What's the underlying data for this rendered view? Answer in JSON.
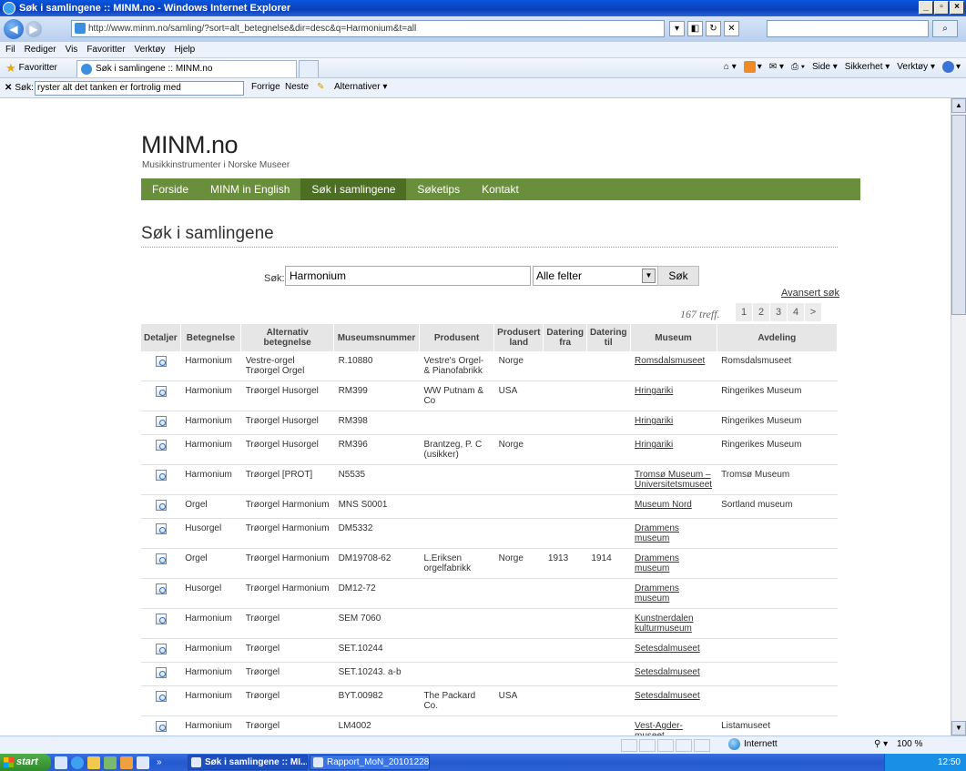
{
  "window": {
    "title": "Søk i samlingene :: MINM.no - Windows Internet Explorer",
    "btn_min": "_",
    "btn_max": "▫",
    "btn_close": "×"
  },
  "addressbar": {
    "back_icon": "◀",
    "forward_icon": "▶",
    "url": "http://www.minm.no/samling/?sort=alt_betegnelse&dir=desc&q=Harmonium&t=all",
    "search_btn_icon": "⌕"
  },
  "menu": [
    "Fil",
    "Rediger",
    "Vis",
    "Favoritter",
    "Verktøy",
    "Hjelp"
  ],
  "favbar": {
    "favorites": "Favoritter",
    "tab_title": "Søk i samlingene :: MINM.no",
    "cmd_side": "Side ▾",
    "cmd_security": "Sikkerhet ▾",
    "cmd_tools": "Verktøy ▾"
  },
  "findbar": {
    "close": "✕",
    "label": "Søk:",
    "value": "ryster alt det tanken er fortrolig med",
    "prev": "Forrige",
    "next": "Neste",
    "options": "Alternativer ▾"
  },
  "site": {
    "title": "MINM.no",
    "subtitle": "Musikkinstrumenter i Norske Museer",
    "nav": [
      "Forside",
      "MINM in English",
      "Søk i samlingene",
      "Søketips",
      "Kontakt"
    ],
    "heading": "Søk i samlingene"
  },
  "search": {
    "label": "Søk:",
    "value": "Harmonium",
    "field_selected": "Alle felter",
    "button": "Søk",
    "advanced": "Avansert søk",
    "hits": "167 treff.",
    "pages": [
      "1",
      "2",
      "3",
      "4",
      ">"
    ]
  },
  "table": {
    "headers": [
      "Detaljer",
      "Betegnelse",
      "Alternativ betegnelse",
      "Museumsnummer",
      "Produsent",
      "Produsert land",
      "Datering fra",
      "Datering til",
      "Museum",
      "Avdeling"
    ],
    "rows": [
      {
        "betegnelse": "Harmonium",
        "alt": "Vestre-orgel Trøorgel Orgel",
        "nr": "R.10880",
        "produsent": "Vestre's Orgel-& Pianofabrikk",
        "land": "Norge",
        "fra": "",
        "til": "",
        "museum": "Romsdalsmuseet",
        "avdeling": "Romsdalsmuseet"
      },
      {
        "betegnelse": "Harmonium",
        "alt": "Trøorgel Husorgel",
        "nr": "RM399",
        "produsent": "WW Putnam & Co",
        "land": "USA",
        "fra": "",
        "til": "",
        "museum": "Hringariki",
        "avdeling": "Ringerikes Museum"
      },
      {
        "betegnelse": "Harmonium",
        "alt": "Trøorgel Husorgel",
        "nr": "RM398",
        "produsent": "",
        "land": "",
        "fra": "",
        "til": "",
        "museum": "Hringariki",
        "avdeling": "Ringerikes Museum"
      },
      {
        "betegnelse": "Harmonium",
        "alt": "Trøorgel Husorgel",
        "nr": "RM396",
        "produsent": "Brantzeg, P. C (usikker)",
        "land": "Norge",
        "fra": "",
        "til": "",
        "museum": "Hringariki",
        "avdeling": "Ringerikes Museum"
      },
      {
        "betegnelse": "Harmonium",
        "alt": "Trøorgel [PROT]",
        "nr": "N5535",
        "produsent": "",
        "land": "",
        "fra": "",
        "til": "",
        "museum": "Tromsø Museum – Universitetsmuseet",
        "avdeling": "Tromsø Museum"
      },
      {
        "betegnelse": "Orgel",
        "alt": "Trøorgel Harmonium",
        "nr": "MNS S0001",
        "produsent": "",
        "land": "",
        "fra": "",
        "til": "",
        "museum": "Museum Nord",
        "avdeling": "Sortland museum"
      },
      {
        "betegnelse": "Husorgel",
        "alt": "Trøorgel Harmonium",
        "nr": "DM5332",
        "produsent": "",
        "land": "",
        "fra": "",
        "til": "",
        "museum": "Drammens museum",
        "avdeling": ""
      },
      {
        "betegnelse": "Orgel",
        "alt": "Trøorgel Harmonium",
        "nr": "DM19708-62",
        "produsent": "L.Eriksen orgelfabrikk",
        "land": "Norge",
        "fra": "1913",
        "til": "1914",
        "museum": "Drammens museum",
        "avdeling": ""
      },
      {
        "betegnelse": "Husorgel",
        "alt": "Trøorgel Harmonium",
        "nr": "DM12-72",
        "produsent": "",
        "land": "",
        "fra": "",
        "til": "",
        "museum": "Drammens museum",
        "avdeling": ""
      },
      {
        "betegnelse": "Harmonium",
        "alt": "Trøorgel",
        "nr": "SEM 7060",
        "produsent": "",
        "land": "",
        "fra": "",
        "til": "",
        "museum": "Kunstnerdalen kulturmuseum",
        "avdeling": ""
      },
      {
        "betegnelse": "Harmonium",
        "alt": "Trøorgel",
        "nr": "SET.10244",
        "produsent": "",
        "land": "",
        "fra": "",
        "til": "",
        "museum": "Setesdalmuseet",
        "avdeling": ""
      },
      {
        "betegnelse": "Harmonium",
        "alt": "Trøorgel",
        "nr": "SET.10243. a-b",
        "produsent": "",
        "land": "",
        "fra": "",
        "til": "",
        "museum": "Setesdalmuseet",
        "avdeling": ""
      },
      {
        "betegnelse": "Harmonium",
        "alt": "Trøorgel",
        "nr": "BYT.00982",
        "produsent": "The Packard Co.",
        "land": "USA",
        "fra": "",
        "til": "",
        "museum": "Setesdalmuseet",
        "avdeling": ""
      },
      {
        "betegnelse": "Harmonium",
        "alt": "Trøorgel",
        "nr": "LM4002",
        "produsent": "",
        "land": "",
        "fra": "",
        "til": "",
        "museum": "Vest-Agder-museet",
        "avdeling": "Listamuseet"
      }
    ]
  },
  "statusbar": {
    "zone": "Internett",
    "zoom": "100 %"
  },
  "taskbar": {
    "start": "start",
    "task1": "Søk i samlingene :: MI...",
    "task2": "Rapport_MoN_20101228...",
    "clock": "12:50"
  }
}
